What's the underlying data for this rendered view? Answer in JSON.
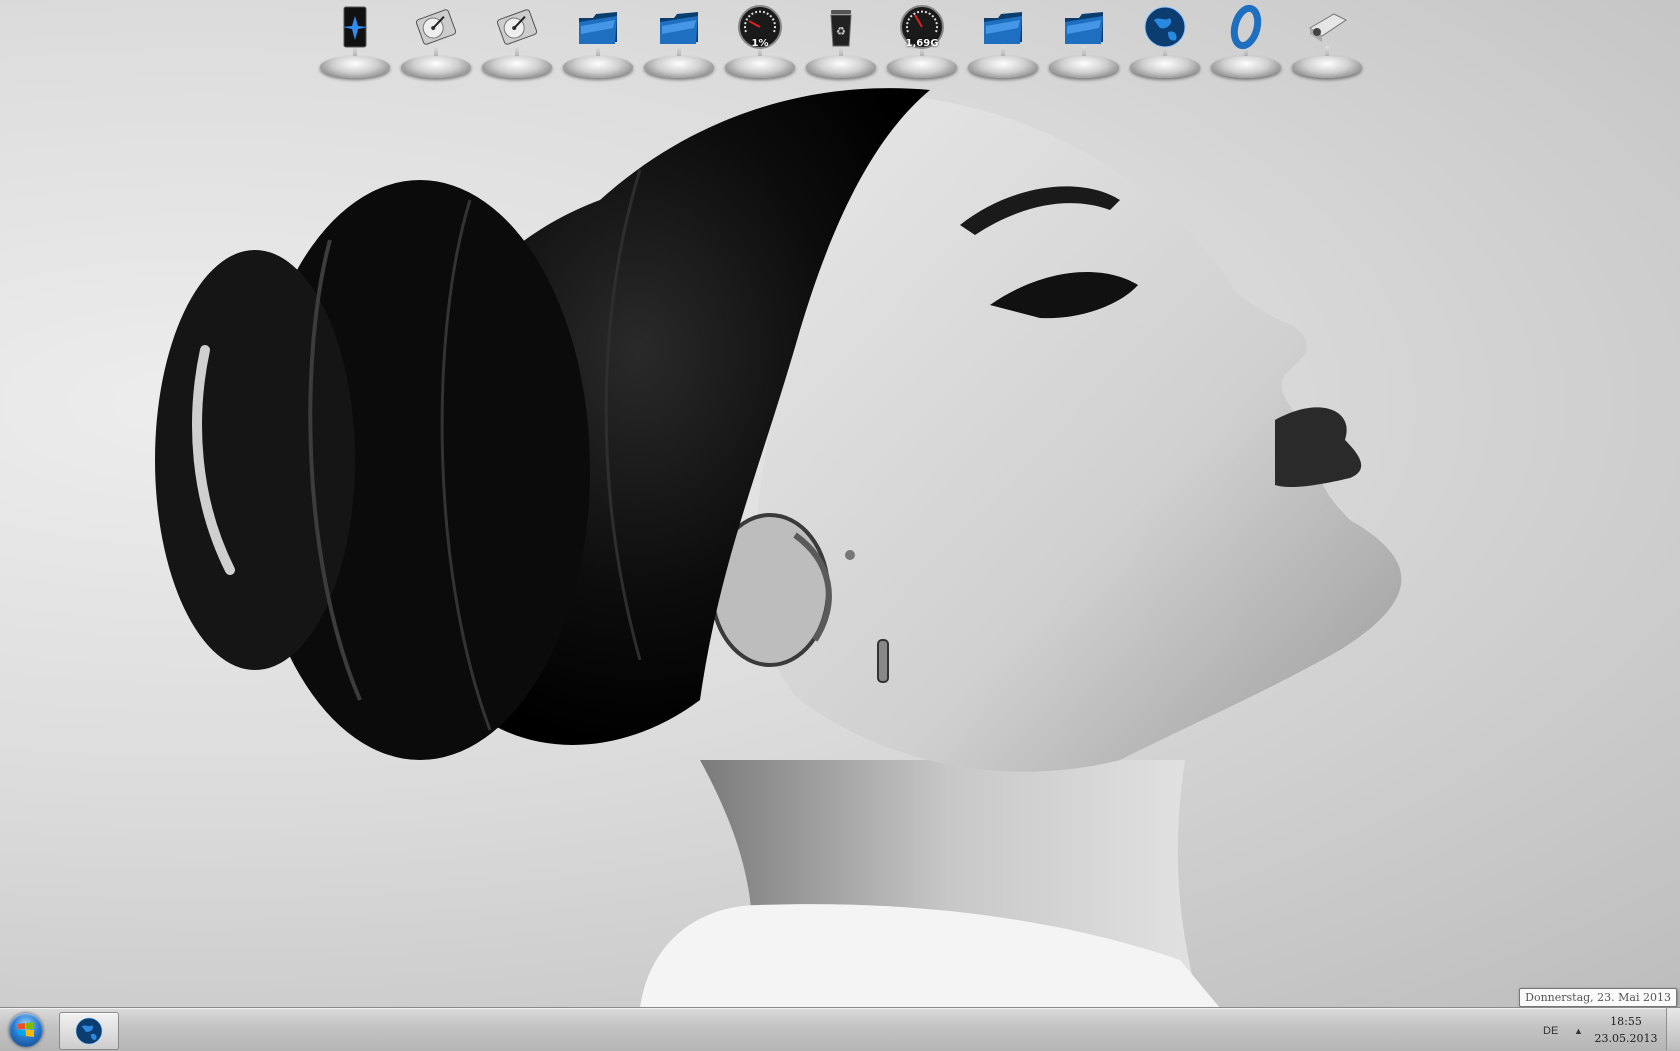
{
  "dock": {
    "items": [
      {
        "name": "computer",
        "icon": "computer-tower-icon"
      },
      {
        "name": "hard-drive-1",
        "icon": "hard-drive-icon"
      },
      {
        "name": "hard-drive-2",
        "icon": "hard-drive-icon"
      },
      {
        "name": "folder-1",
        "icon": "folder-icon"
      },
      {
        "name": "folder-2",
        "icon": "folder-icon"
      },
      {
        "name": "cpu-gauge",
        "icon": "gauge-icon",
        "value": "1%"
      },
      {
        "name": "recycle-bin",
        "icon": "trash-icon"
      },
      {
        "name": "ram-gauge",
        "icon": "gauge-icon",
        "value": "1,69G"
      },
      {
        "name": "folder-3",
        "icon": "folder-icon"
      },
      {
        "name": "folder-4",
        "icon": "folder-icon"
      },
      {
        "name": "globe",
        "icon": "globe-icon"
      },
      {
        "name": "opera",
        "icon": "opera-icon"
      },
      {
        "name": "projector",
        "icon": "projector-icon"
      }
    ]
  },
  "tooltip": {
    "date_long": "Donnerstag, 23. Mai 2013"
  },
  "taskbar": {
    "start_icon": "windows-logo-icon",
    "pinned_app_icon": "globe-icon",
    "language": "DE",
    "tray_arrow": "▲",
    "time": "18:55",
    "date": "23.05.2013"
  },
  "colors": {
    "accent_blue": "#1f6fc0",
    "taskbar_top": "#dadada",
    "taskbar_bottom": "#b5b5b5"
  }
}
